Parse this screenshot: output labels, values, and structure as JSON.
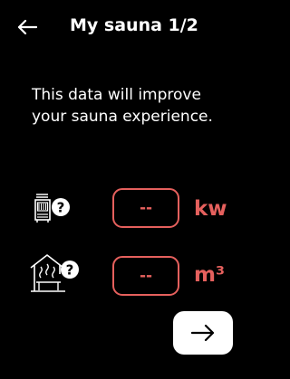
{
  "header": {
    "title": "My sauna 1/2",
    "back_icon": "arrow-left-icon"
  },
  "intro": {
    "text": "This data will improve your sauna experience."
  },
  "power": {
    "icon": "heater-help-icon",
    "value": "--",
    "unit": "kw"
  },
  "volume": {
    "icon": "sauna-room-help-icon",
    "value": "--",
    "unit": "m³"
  },
  "next": {
    "icon": "arrow-right-icon"
  },
  "colors": {
    "background": "#000000",
    "accent": "#e5605d",
    "text": "#ffffff",
    "next_button_bg": "#ffffff"
  }
}
